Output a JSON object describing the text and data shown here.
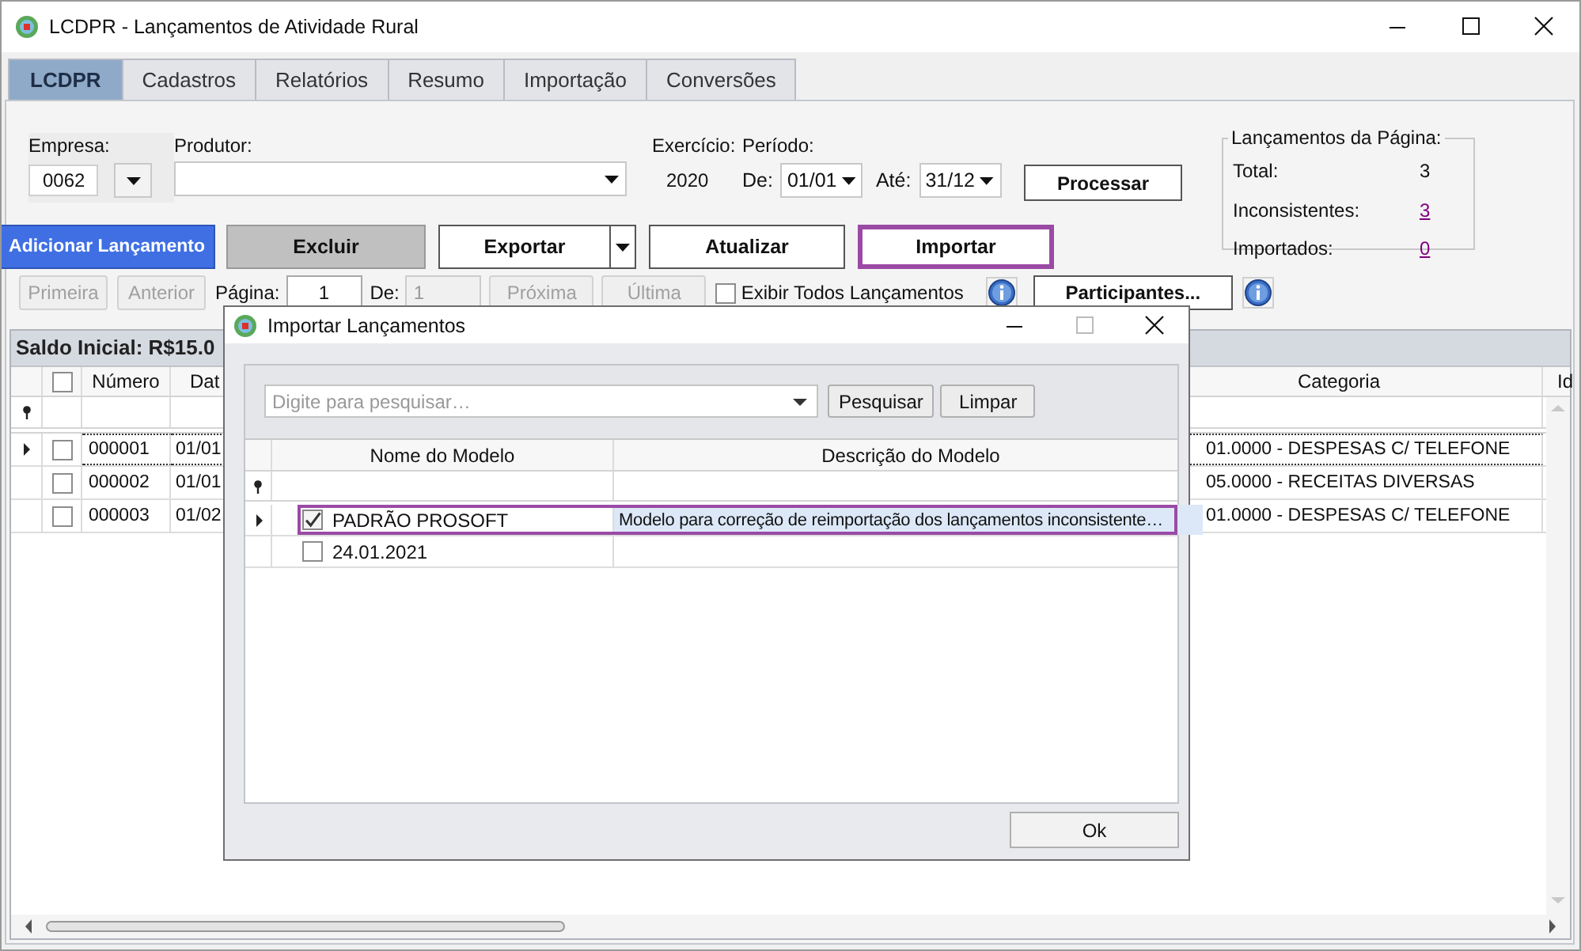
{
  "window": {
    "title": "LCDPR - Lançamentos de Atividade Rural"
  },
  "tabs": [
    {
      "label": "LCDPR",
      "selected": true
    },
    {
      "label": "Cadastros",
      "selected": false
    },
    {
      "label": "Relatórios",
      "selected": false
    },
    {
      "label": "Resumo",
      "selected": false
    },
    {
      "label": "Importação",
      "selected": false
    },
    {
      "label": "Conversões",
      "selected": false
    }
  ],
  "filters": {
    "empresa_label": "Empresa:",
    "empresa_value": "0062",
    "produtor_label": "Produtor:",
    "exercicio_label": "Exercício:",
    "exercicio_value": "2020",
    "periodo_label": "Período:",
    "de_label": "De:",
    "de_value": "01/01",
    "ate_label": "Até:",
    "ate_value": "31/12",
    "process_button": "Processar"
  },
  "page_summary": {
    "title": "Lançamentos da Página:",
    "items": [
      {
        "label": "Total:",
        "value": "3",
        "kind": "plain"
      },
      {
        "label": "Inconsistentes:",
        "value": "3",
        "kind": "link"
      },
      {
        "label": "Importados:",
        "value": "0",
        "kind": "link"
      }
    ]
  },
  "actions": [
    {
      "label": "Adicionar Lançamento",
      "kind": "primary",
      "highlighted": false
    },
    {
      "label": "Excluir",
      "kind": "gray",
      "highlighted": false
    },
    {
      "label": "Exportar",
      "kind": "split",
      "highlighted": false
    },
    {
      "label": "Atualizar",
      "kind": "plain",
      "highlighted": false
    },
    {
      "label": "Importar",
      "kind": "plain",
      "highlighted": true
    }
  ],
  "pager": {
    "first": "Primeira",
    "previous": "Anterior",
    "page_label": "Página:",
    "page_value": "1",
    "of_label": "De:",
    "of_value": "1",
    "next": "Próxima",
    "last": "Última",
    "show_all": {
      "label": "Exibir Todos Lançamentos",
      "checked": false
    },
    "participants_button": "Participantes..."
  },
  "grid": {
    "caption": "Saldo Inicial: R$15.0",
    "select_all_checked": false,
    "columns": [
      "Número",
      "Dat",
      "Categoria",
      "Id"
    ],
    "rows": [
      {
        "number": "000001",
        "date": "01/01",
        "category": "01.0000 - DESPESAS C/ TELEFONE",
        "checked": false,
        "current": true
      },
      {
        "number": "000002",
        "date": "01/01",
        "category": "05.0000 - RECEITAS DIVERSAS",
        "checked": false,
        "current": false
      },
      {
        "number": "000003",
        "date": "01/02",
        "category": "01.0000 - DESPESAS C/ TELEFONE",
        "checked": false,
        "current": false
      }
    ]
  },
  "dialog": {
    "title": "Importar Lançamentos",
    "search": {
      "placeholder": "Digite para pesquisar…"
    },
    "buttons": [
      "Pesquisar",
      "Limpar"
    ],
    "columns": [
      "Nome do Modelo",
      "Descrição do Modelo"
    ],
    "rows": [
      {
        "name": "PADRÃO PROSOFT",
        "description": "Modelo para correção de reimportação dos lançamentos inconsistente…",
        "checked": true,
        "selected": true
      },
      {
        "name": "24.01.2021",
        "checked": false,
        "selected": false
      }
    ],
    "ok_button": "Ok"
  }
}
